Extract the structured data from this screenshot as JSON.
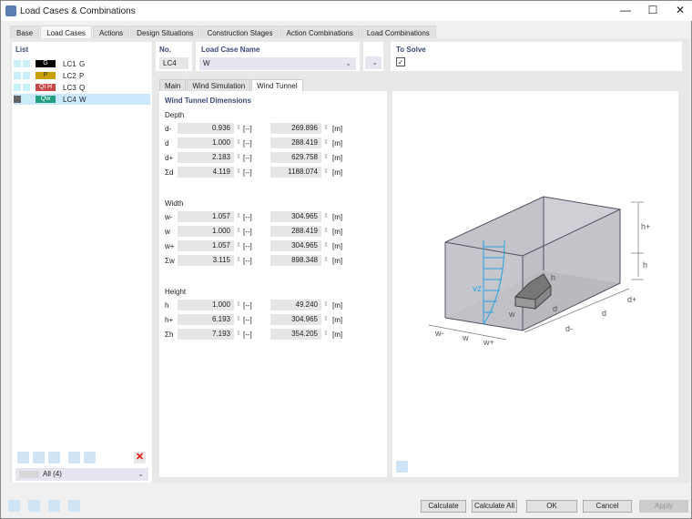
{
  "window": {
    "title": "Load Cases & Combinations",
    "minimize": "—",
    "maximize": "☐",
    "close": "✕"
  },
  "tabs": [
    "Base",
    "Load Cases",
    "Actions",
    "Design Situations",
    "Construction Stages",
    "Action Combinations",
    "Load Combinations"
  ],
  "active_tab": "Load Cases",
  "list": {
    "title": "List",
    "items": [
      {
        "badge": "G",
        "badge_color": "#000000",
        "badge_text_color": "#ffffff",
        "no": "LC1",
        "name": "G"
      },
      {
        "badge": "P",
        "badge_color": "#c8a000",
        "badge_text_color": "#333333",
        "no": "LC2",
        "name": "P"
      },
      {
        "badge": "Qi H",
        "badge_color": "#c84848",
        "badge_text_color": "#ffffff",
        "no": "LC3",
        "name": "Q"
      },
      {
        "badge": "Qw",
        "badge_color": "#20a080",
        "badge_text_color": "#ffffff",
        "no": "LC4",
        "name": "W",
        "selected": true
      }
    ],
    "filter": "All (4)"
  },
  "header": {
    "no_label": "No.",
    "no_value": "LC4",
    "name_label": "Load Case Name",
    "name_value": "W",
    "to_solve_label": "To Solve",
    "to_solve_checked": true
  },
  "subtabs": [
    "Main",
    "Wind Simulation",
    "Wind Tunnel"
  ],
  "active_subtab": "Wind Tunnel",
  "wind_tunnel": {
    "title": "Wind Tunnel Dimensions",
    "groups": [
      {
        "label": "Depth",
        "rows": [
          {
            "name": "d-",
            "factor": "0.936",
            "factor_unit": "[--]",
            "value": "269.896",
            "unit": "[m]"
          },
          {
            "name": "d",
            "factor": "1.000",
            "factor_unit": "[--]",
            "value": "288.419",
            "unit": "[m]"
          },
          {
            "name": "d+",
            "factor": "2.183",
            "factor_unit": "[--]",
            "value": "629.758",
            "unit": "[m]"
          },
          {
            "name": "Σd",
            "factor": "4.119",
            "factor_unit": "[--]",
            "value": "1188.074",
            "unit": "[m]"
          }
        ]
      },
      {
        "label": "Width",
        "rows": [
          {
            "name": "w-",
            "factor": "1.057",
            "factor_unit": "[--]",
            "value": "304.965",
            "unit": "[m]"
          },
          {
            "name": "w",
            "factor": "1.000",
            "factor_unit": "[--]",
            "value": "288.419",
            "unit": "[m]"
          },
          {
            "name": "w+",
            "factor": "1.057",
            "factor_unit": "[--]",
            "value": "304.965",
            "unit": "[m]"
          },
          {
            "name": "Σw",
            "factor": "3.115",
            "factor_unit": "[--]",
            "value": "898.348",
            "unit": "[m]"
          }
        ]
      },
      {
        "label": "Height",
        "rows": [
          {
            "name": "h",
            "factor": "1.000",
            "factor_unit": "[--]",
            "value": "49.240",
            "unit": "[m]"
          },
          {
            "name": "h+",
            "factor": "6.193",
            "factor_unit": "[--]",
            "value": "304.965",
            "unit": "[m]"
          },
          {
            "name": "Σh",
            "factor": "7.193",
            "factor_unit": "[--]",
            "value": "354.205",
            "unit": "[m]"
          }
        ]
      }
    ]
  },
  "diagram": {
    "labels": {
      "hplus": "h+",
      "h_tunnel": "h",
      "h_building": "h",
      "vz": "vz",
      "w": "w",
      "d_building": "d",
      "dplus": "d+",
      "d": "d",
      "dminus": "d-",
      "wminus": "w-",
      "w_bottom": "w",
      "wplus": "w+"
    }
  },
  "footer": {
    "calculate": "Calculate",
    "calculate_all": "Calculate All",
    "ok": "OK",
    "cancel": "Cancel",
    "apply": "Apply"
  }
}
